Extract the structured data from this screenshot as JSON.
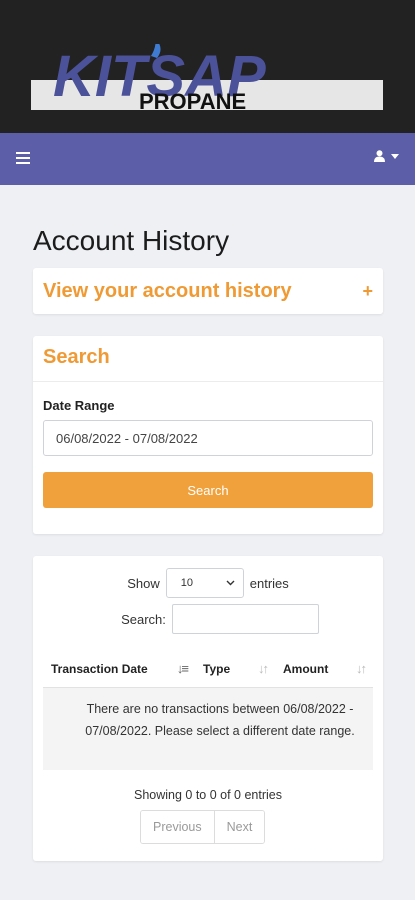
{
  "brand": {
    "logo_main": "KITSAP",
    "logo_sub": "PROPANE"
  },
  "navbar": {
    "menu_icon": "hamburger-icon",
    "user_icon": "user-icon",
    "caret_icon": "caret-down-icon"
  },
  "page": {
    "title": "Account History"
  },
  "collapse_panel": {
    "heading": "View your account history",
    "toggle": "+"
  },
  "search_panel": {
    "heading": "Search",
    "date_label": "Date Range",
    "date_value": "06/08/2022 - 07/08/2022",
    "button_label": "Search"
  },
  "table_panel": {
    "show_label": "Show",
    "page_size": "10",
    "entries_label": "entries",
    "search_label": "Search:",
    "columns": [
      "Transaction Date",
      "Type",
      "Amount"
    ],
    "empty_message": "There are no transactions between 06/08/2022 - 07/08/2022. Please select a different date range.",
    "info": "Showing 0 to 0 of 0 entries",
    "prev_label": "Previous",
    "next_label": "Next"
  },
  "colors": {
    "accent": "#ef9a34",
    "navbar": "#5c5ea8",
    "header": "#222222",
    "background": "#eef0f4"
  }
}
